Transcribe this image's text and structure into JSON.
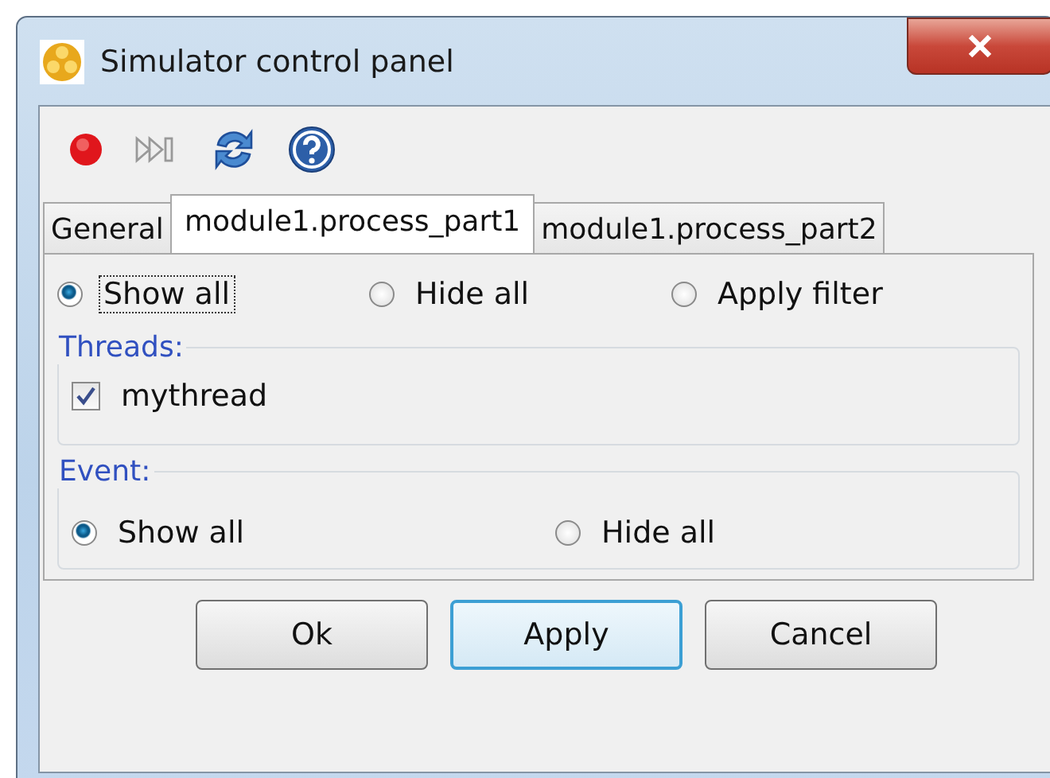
{
  "window": {
    "title": "Simulator control panel"
  },
  "tabs": [
    {
      "label": "General",
      "selected": false
    },
    {
      "label": "module1.process_part1",
      "selected": true
    },
    {
      "label": "module1.process_part2",
      "selected": false
    }
  ],
  "filter": [
    {
      "label": "Show all",
      "selected": true,
      "focused": true
    },
    {
      "label": "Hide all",
      "selected": false,
      "focused": false
    },
    {
      "label": "Apply filter",
      "selected": false,
      "focused": false
    }
  ],
  "threads": {
    "title": "Threads:",
    "items": [
      {
        "label": "mythread",
        "checked": true
      }
    ]
  },
  "event": {
    "title": "Event:",
    "options": [
      {
        "label": "Show all",
        "selected": true
      },
      {
        "label": "Hide all",
        "selected": false
      }
    ]
  },
  "buttons": [
    {
      "label": "Ok",
      "focused": false
    },
    {
      "label": "Apply",
      "focused": true
    },
    {
      "label": "Cancel",
      "focused": false
    }
  ]
}
